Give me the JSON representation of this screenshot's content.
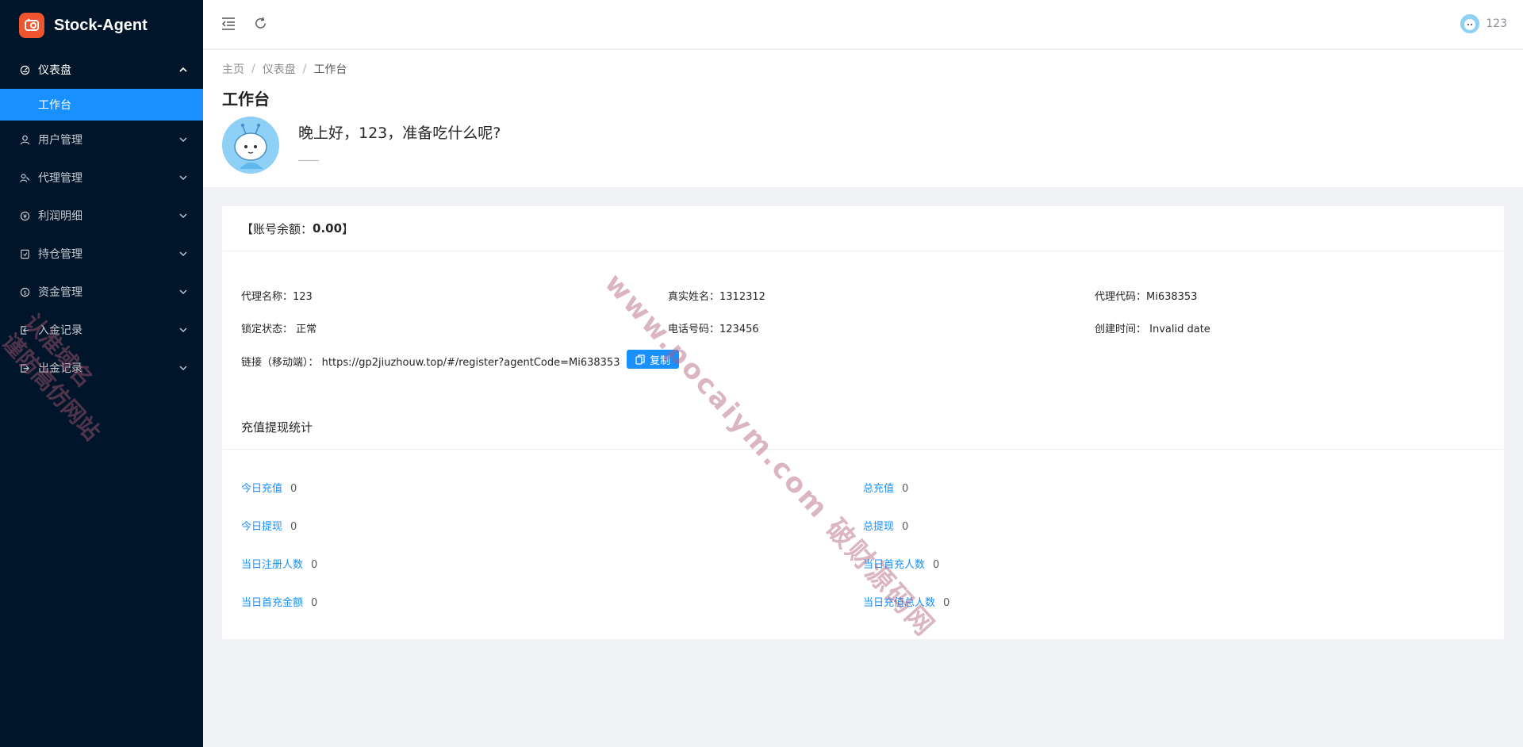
{
  "app": {
    "name": "Stock-Agent"
  },
  "sidebar": {
    "items": [
      {
        "label": "仪表盘",
        "icon": "dashboard-icon",
        "open": true
      },
      {
        "label": "用户管理",
        "icon": "user-icon"
      },
      {
        "label": "代理管理",
        "icon": "team-icon"
      },
      {
        "label": "利润明细",
        "icon": "profit-icon"
      },
      {
        "label": "持仓管理",
        "icon": "position-icon"
      },
      {
        "label": "资金管理",
        "icon": "money-icon"
      },
      {
        "label": "入金记录",
        "icon": "deposit-icon"
      },
      {
        "label": "出金记录",
        "icon": "withdraw-icon"
      }
    ],
    "active_sub": "工作台"
  },
  "header": {
    "username": "123"
  },
  "breadcrumb": {
    "home": "主页",
    "level1": "仪表盘",
    "current": "工作台",
    "sep": "/"
  },
  "page": {
    "title": "工作台",
    "greeting": "晚上好，123，准备吃什么呢?"
  },
  "account": {
    "balance_label": "【账号余额：",
    "balance_value": "0.00",
    "balance_suffix": "】",
    "agent_name": "代理名称：123",
    "real_name": "真实姓名：1312312",
    "agent_code": "代理代码：Mi638353",
    "lock_status": "锁定状态：  正常",
    "phone": "电话号码：123456",
    "created": "创建时间：  Invalid date",
    "link": "链接（移动端）：  https://gp2jiuzhouw.top/#/register?agentCode=Mi638353",
    "copy_label": "复制"
  },
  "stats": {
    "title": "充值提现统计",
    "today_recharge": {
      "label": "今日充值",
      "value": "0"
    },
    "total_recharge": {
      "label": "总充值",
      "value": "0"
    },
    "today_withdraw": {
      "label": "今日提现",
      "value": "0"
    },
    "total_withdraw": {
      "label": "总提现",
      "value": "0"
    },
    "today_register": {
      "label": "当日注册人数",
      "value": "0"
    },
    "today_first_recharge_users": {
      "label": "当日首充人数",
      "value": "0"
    },
    "today_first_recharge_amount": {
      "label": "当日首充金额",
      "value": "0"
    },
    "today_recharge_users": {
      "label": "当日充值总人数",
      "value": "0"
    }
  },
  "watermark": {
    "main": "www.pocaiym.com  破财源码网",
    "side_line1": "认准域名",
    "side_line2": "谨防高仿网站"
  },
  "colors": {
    "sidebar_bg": "#001529",
    "primary": "#1890ff",
    "logo": "#ee5430"
  }
}
